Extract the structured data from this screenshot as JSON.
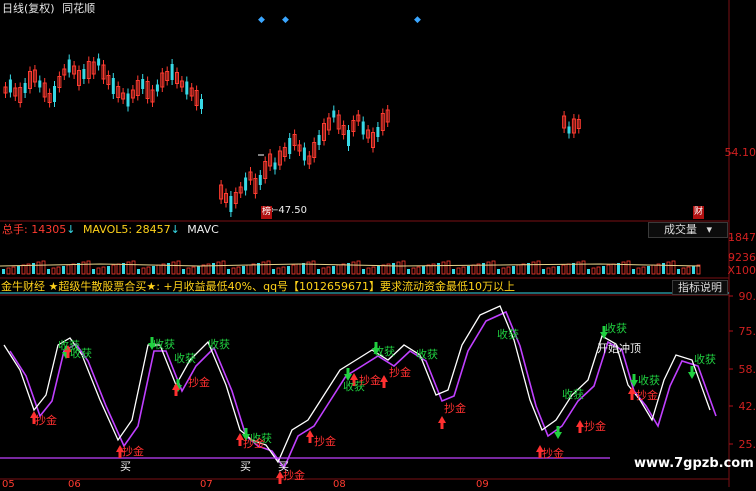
{
  "header": {
    "title": "日线(复权)",
    "app": "同花顺"
  },
  "price_pane": {
    "low_marker": "47.50",
    "low_tag": "榜",
    "right_tag": "财",
    "axis_label": "54.10"
  },
  "volume_pane": {
    "total_label": "总手:",
    "total_value": "14305",
    "mavol5_label": "MAVOL5:",
    "mavol5_value": "28457",
    "mavol_more": "MAVC",
    "dropdown": "成交量",
    "axis": [
      "1847",
      "9236",
      "X100"
    ]
  },
  "indicator_pane": {
    "name": "金牛财经",
    "description": "★超级牛散股票合买★: +月收益最低40%、qq号【1012659671】要求流动资金最低10万以上",
    "button": "指标说明",
    "axis": [
      "90.",
      "75.",
      "58.",
      "42.",
      "25."
    ],
    "watermark": "www.7gpzb.com",
    "signals": {
      "harvest": "收获",
      "gold": "抄金",
      "buy": "买",
      "peak": "开始冲顶"
    }
  },
  "x_axis": [
    "05",
    "06",
    "07",
    "08",
    "09"
  ],
  "colors": {
    "up": "#ff3b30",
    "down": "#38d9e6",
    "purple": "#c040ff",
    "white": "#ffffff",
    "gold": "#ffd21a",
    "sep": "#b0101a"
  }
}
